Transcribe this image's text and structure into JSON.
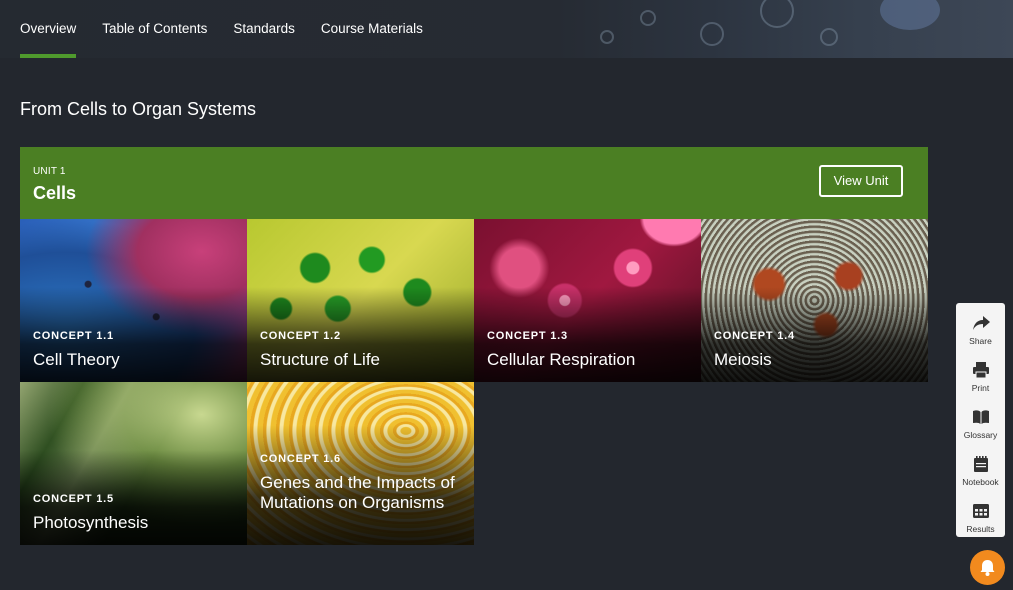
{
  "tabs": [
    {
      "label": "Overview",
      "active": true
    },
    {
      "label": "Table of Contents",
      "active": false
    },
    {
      "label": "Standards",
      "active": false
    },
    {
      "label": "Course Materials",
      "active": false
    }
  ],
  "page_title": "From Cells to Organ Systems",
  "unit": {
    "kicker": "UNIT 1",
    "name": "Cells",
    "view_label": "View Unit",
    "color": "#4b7f23"
  },
  "concepts": [
    {
      "label": "CONCEPT 1.1",
      "title": "Cell Theory"
    },
    {
      "label": "CONCEPT 1.2",
      "title": "Structure of Life"
    },
    {
      "label": "CONCEPT 1.3",
      "title": "Cellular Respiration"
    },
    {
      "label": "CONCEPT 1.4",
      "title": "Meiosis"
    },
    {
      "label": "CONCEPT 1.5",
      "title": "Photosynthesis"
    },
    {
      "label": "CONCEPT 1.6",
      "title": "Genes and the Impacts of Mutations on Organisms"
    }
  ],
  "sidebar": [
    {
      "label": "Share",
      "icon": "share-icon"
    },
    {
      "label": "Print",
      "icon": "print-icon"
    },
    {
      "label": "Glossary",
      "icon": "book-icon"
    },
    {
      "label": "Notebook",
      "icon": "notebook-icon"
    },
    {
      "label": "Results",
      "icon": "results-icon"
    }
  ],
  "colors": {
    "accent": "#4f9a2d",
    "notification": "#f28a1e",
    "background": "#23272e"
  }
}
